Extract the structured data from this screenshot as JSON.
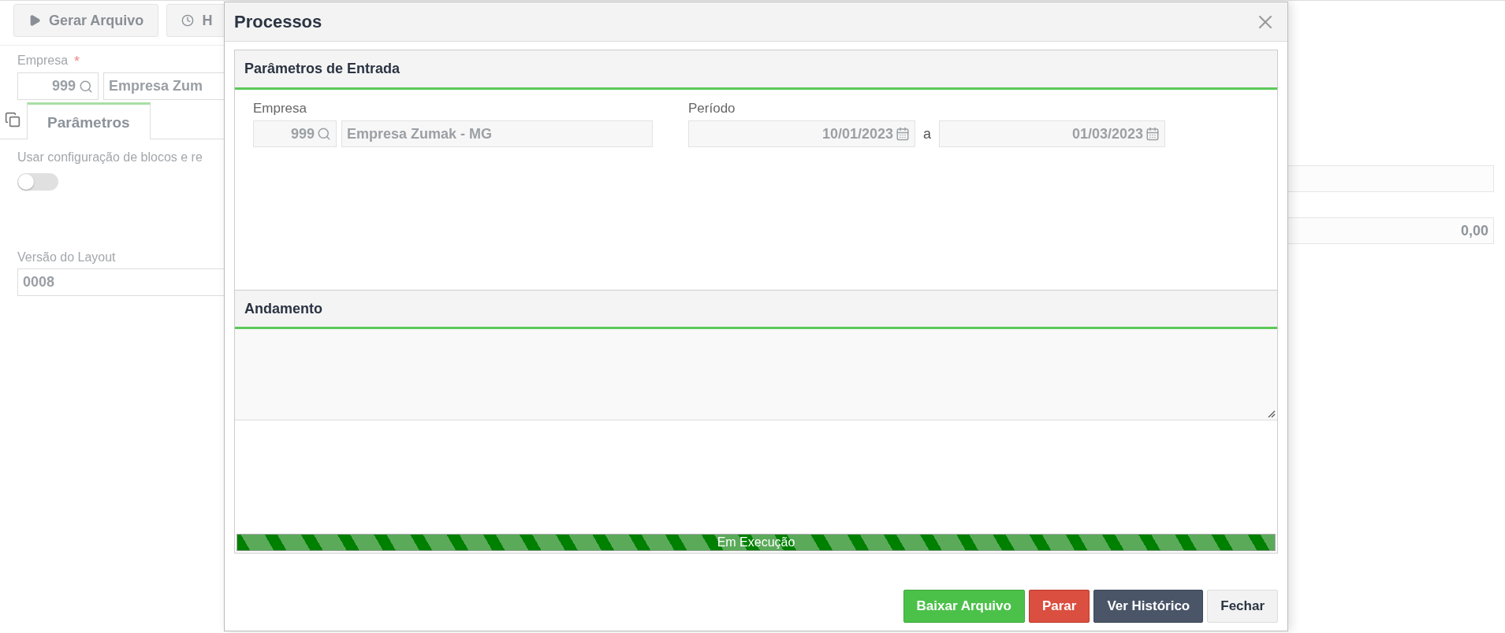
{
  "toolbar": {
    "buttons": [
      {
        "label": "Gerar Arquivo"
      },
      {
        "label": "H"
      }
    ]
  },
  "form": {
    "empresa": {
      "label": "Empresa",
      "required_mark": "*",
      "code": "999",
      "name": "Empresa Zum"
    },
    "tabs": [
      {
        "label": "Parâmetros",
        "selected": true
      }
    ],
    "toggle": {
      "label": "Usar configuração de blocos e re",
      "on": false
    },
    "layout_version": {
      "label": "Versão do Layout",
      "value": "0008"
    },
    "right_value": "0,00"
  },
  "dialog": {
    "title": "Processos",
    "entry": {
      "title": "Parâmetros de Entrada",
      "empresa": {
        "label": "Empresa",
        "code": "999",
        "name": "Empresa Zumak - MG"
      },
      "period": {
        "label": "Período",
        "start": "10/01/2023",
        "separator": "a",
        "end": "01/03/2023"
      }
    },
    "progress": {
      "title": "Andamento",
      "status": "Em Execução",
      "level": 1
    },
    "buttons": [
      {
        "label": "Baixar Arquivo",
        "kind": "success"
      },
      {
        "label": "Parar",
        "kind": "danger"
      },
      {
        "label": "Ver Histórico",
        "kind": "dark"
      },
      {
        "label": "Fechar",
        "kind": "plain"
      }
    ]
  }
}
